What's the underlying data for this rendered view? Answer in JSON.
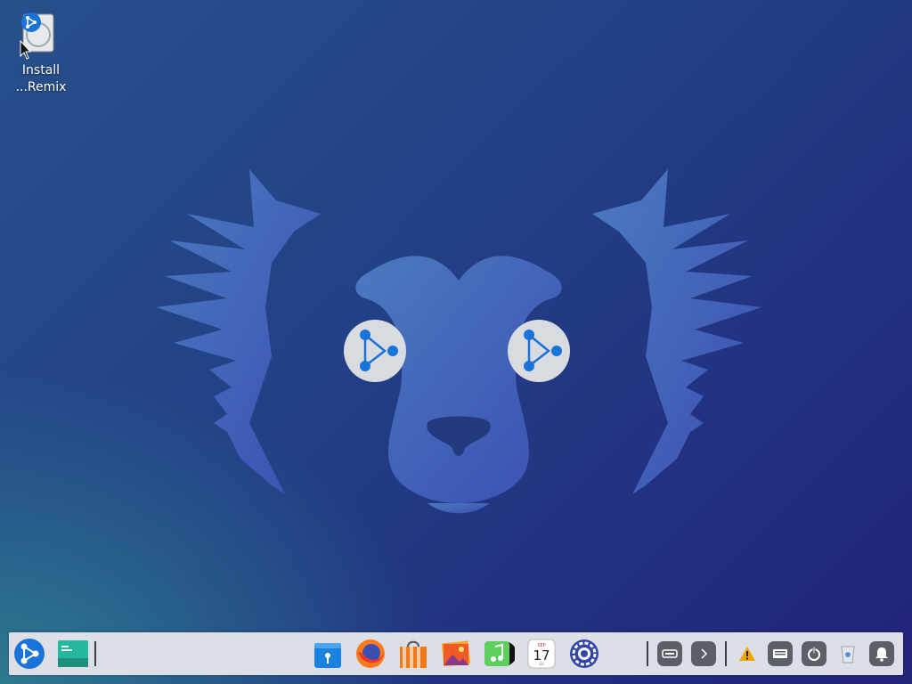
{
  "desktop": {
    "icons": [
      {
        "label_line1": "Install",
        "label_line2": "...Remix"
      }
    ]
  },
  "dock": {
    "launcher_icon": "remix-launcher-icon",
    "taskbar_icon": "terminal-icon",
    "pinned_apps": [
      {
        "name": "file-manager-icon"
      },
      {
        "name": "firefox-icon"
      },
      {
        "name": "app-store-icon"
      },
      {
        "name": "photos-icon"
      },
      {
        "name": "music-icon"
      },
      {
        "name": "calendar-icon",
        "month": "SEP",
        "day": "17",
        "weekday": "SU"
      },
      {
        "name": "settings-icon"
      }
    ],
    "tray": [
      {
        "name": "keyboard-toggle-icon"
      },
      {
        "name": "expand-tray-icon"
      },
      {
        "name": "warning-icon"
      },
      {
        "name": "keyboard-icon"
      },
      {
        "name": "power-icon"
      },
      {
        "name": "trash-icon"
      },
      {
        "name": "notification-icon"
      }
    ]
  },
  "colors": {
    "accent": "#1a73d9",
    "wallpaper_mascot": "#3c64b4",
    "dock_bg": "#dcdfe5"
  }
}
